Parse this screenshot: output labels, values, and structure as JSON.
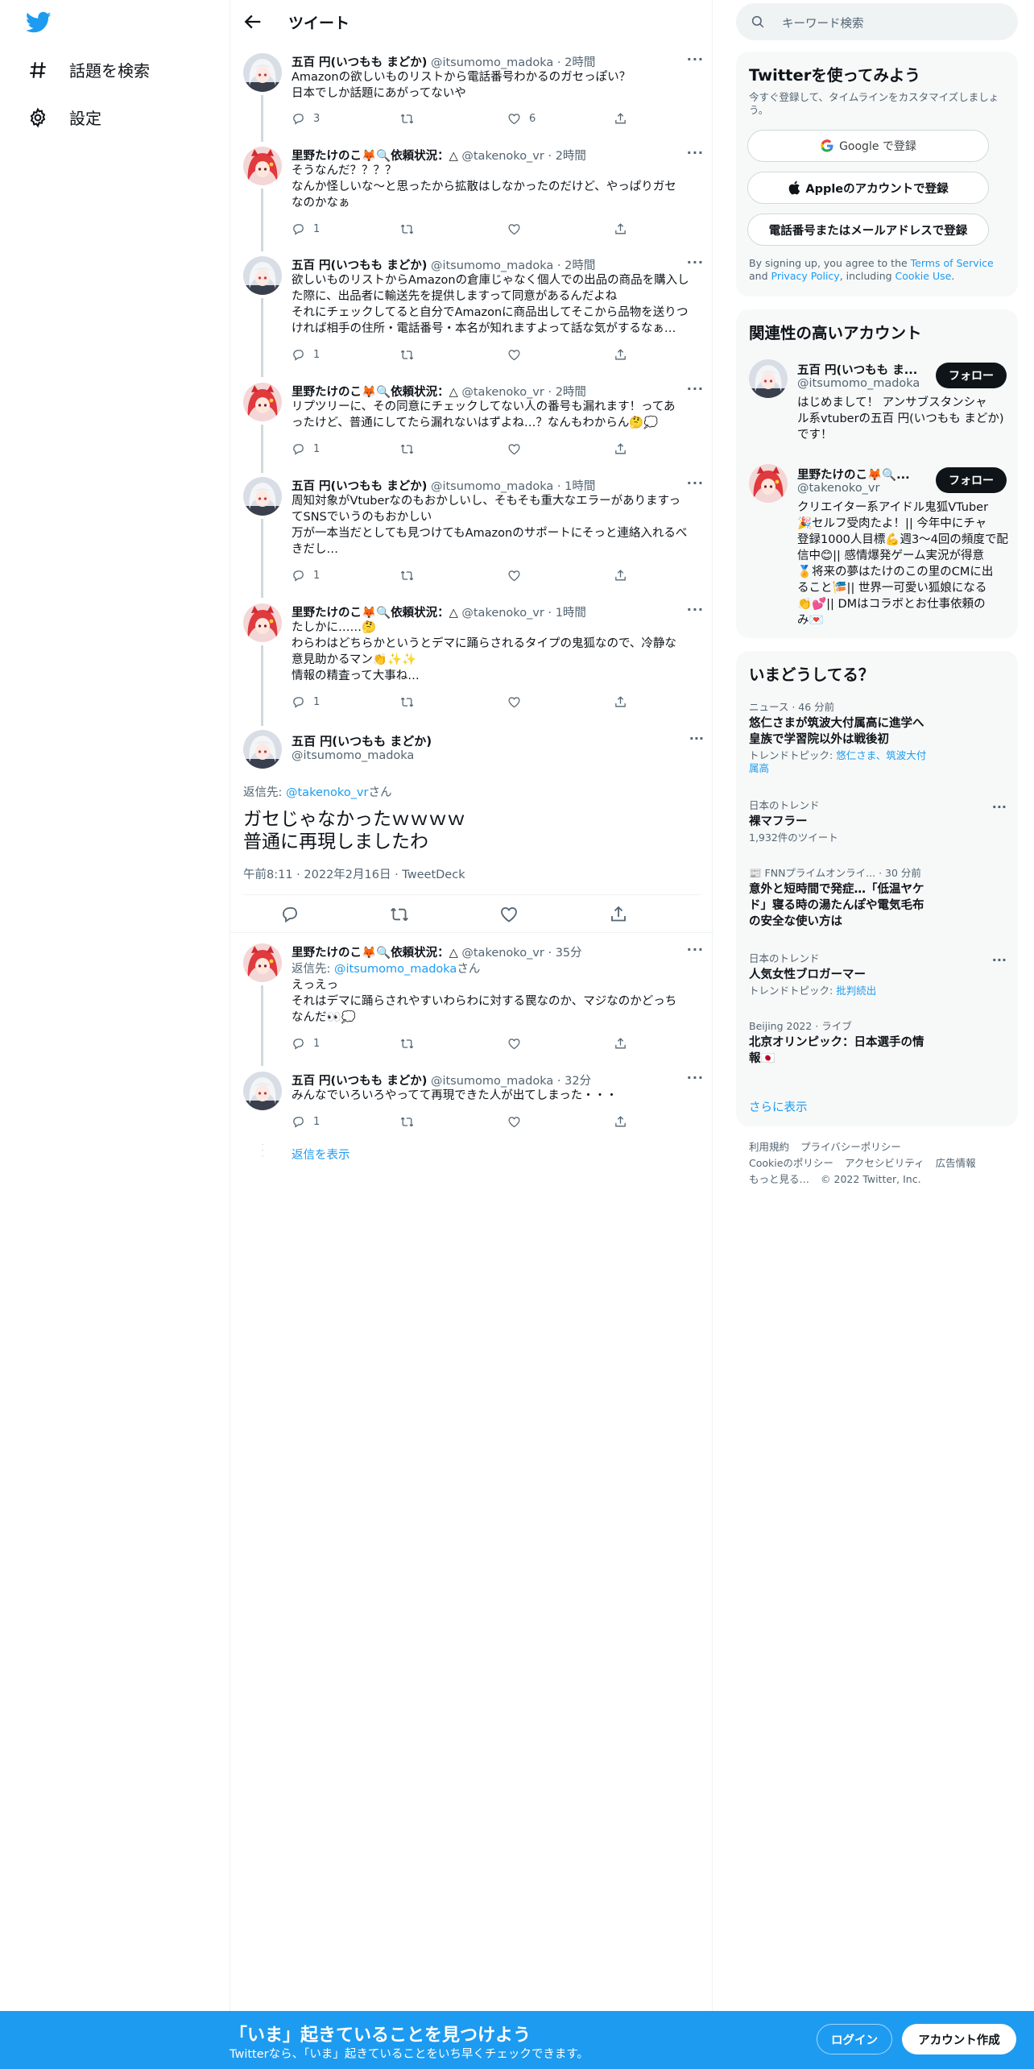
{
  "nav": {
    "logo": "twitter-bird",
    "items": [
      {
        "label": "話題を検索",
        "icon": "hash-icon"
      },
      {
        "label": "設定",
        "icon": "gear-icon"
      }
    ]
  },
  "header": {
    "title": "ツイート"
  },
  "tweets": [
    {
      "name": "五百 円(いつもも まどか)",
      "handle": "@itsumomo_madoka",
      "time": "2時間",
      "lines": [
        "Amazonの欲しいものリストから電話番号わかるのガセっぽい？",
        "日本でしか話題にあがってないや"
      ],
      "replies": "3",
      "retweets": "",
      "likes": "6"
    },
    {
      "name": "里野たけのこ🦊🔍依頼状況：△",
      "handle": "@takenoko_vr",
      "time": "2時間",
      "lines": [
        "そうなんだ？？？？",
        "なんか怪しいな～と思ったから拡散はしなかったのだけど、やっぱりガセ",
        "なのかなぁ"
      ],
      "replies": "1",
      "retweets": "",
      "likes": ""
    },
    {
      "name": "五百 円(いつもも まどか)",
      "handle": "@itsumomo_madoka",
      "time": "2時間",
      "lines": [
        "欲しいものリストからAmazonの倉庫じゃなく個人での出品の商品を購入し",
        "た際に、出品者に輸送先を提供しますって同意があるんだよね",
        "それにチェックしてると自分でAmazonに商品出してそこから品物を送りつ",
        "ければ相手の住所・電話番号・本名が知れますよって話な気がするなぁ…"
      ],
      "replies": "1",
      "retweets": "",
      "likes": ""
    },
    {
      "name": "里野たけのこ🦊🔍依頼状況：△",
      "handle": "@takenoko_vr",
      "time": "2時間",
      "lines": [
        "リプツリーに、その同意にチェックしてない人の番号も漏れます！ってあ",
        "ったけど、普通にしてたら漏れないはずよね…？なんもわからん🤔💭"
      ],
      "replies": "1",
      "retweets": "",
      "likes": ""
    },
    {
      "name": "五百 円(いつもも まどか)",
      "handle": "@itsumomo_madoka",
      "time": "1時間",
      "lines": [
        "周知対象がVtuberなのもおかしいし、そもそも重大なエラーがありますっ",
        "てSNSでいうのもおかしい",
        "万が一本当だとしても見つけてもAmazonのサポートにそっと連絡入れるべ",
        "きだし…"
      ],
      "replies": "1",
      "retweets": "",
      "likes": ""
    },
    {
      "name": "里野たけのこ🦊🔍依頼状況：△",
      "handle": "@takenoko_vr",
      "time": "1時間",
      "lines": [
        "たしかに……🤔",
        "わらわはどちらかというとデマに踊らされるタイプの鬼狐なので、冷静な",
        "意見助かるマン👏✨✨",
        "情報の精査って大事ね…"
      ],
      "replies": "1",
      "retweets": "",
      "likes": ""
    }
  ],
  "main_tweet": {
    "name": "五百 円(いつもも まどか)",
    "handle": "@itsumomo_madoka",
    "reply_prefix": "返信先: ",
    "reply_to": "@takenoko_vr",
    "reply_suffix": "さん",
    "lines": [
      "ガセじゃなかったｗｗｗｗ",
      "普通に再現しましたわ"
    ],
    "timestamp": "午前8:11 · 2022年2月16日 · TweetDeck"
  },
  "replies": [
    {
      "name": "里野たけのこ🦊🔍依頼状況：△",
      "handle": "@takenoko_vr",
      "time": "35分",
      "reply_prefix": "返信先: ",
      "reply_to": "@itsumomo_madoka",
      "reply_suffix": "さん",
      "lines": [
        "えっえっ",
        "それはデマに踊らされやすいわらわに対する罠なのか、マジなのかどっち",
        "なんだ👀💭"
      ],
      "replies": "1",
      "retweets": "",
      "likes": ""
    },
    {
      "name": "五百 円(いつもも まどか)",
      "handle": "@itsumomo_madoka",
      "time": "32分",
      "lines": [
        "みんなでいろいろやってて再現できた人が出てしまった・・・"
      ],
      "replies": "1",
      "retweets": "",
      "likes": ""
    }
  ],
  "show_replies": "返信を表示",
  "right": {
    "search_placeholder": "キーワード検索",
    "signup": {
      "title": "Twitterを使ってみよう",
      "subtitle": "今すぐ登録して、タイムラインをカスタマイズしましょう。",
      "google": "Google で登録",
      "apple": "Appleのアカウントで登録",
      "phone": "電話番号またはメールアドレスで登録",
      "terms_pre": "By signing up, you agree to the ",
      "terms_link": "Terms of Service",
      "terms_and": " and ",
      "privacy_link": "Privacy Policy",
      "terms_mid": ", including ",
      "cookie_link": "Cookie Use",
      "terms_end": "."
    },
    "related": {
      "title": "関連性の高いアカウント",
      "follow_label": "フォロー",
      "accounts": [
        {
          "name": "五百 円(いつもも ま...",
          "handle": "@itsumomo_madoka",
          "bio_lines": [
            "はじめまして！ アンサブスタンシャ",
            "ル系vtuberの五百 円(いつもも まどか)",
            "です！"
          ]
        },
        {
          "name": "里野たけのこ🦊🔍...",
          "handle": "@takenoko_vr",
          "bio_lines": [
            "クリエイター系アイドル鬼狐VTuber",
            "🎉セルフ受肉たよ！|| 今年中にチャ",
            "登録1000人目標💪週3〜4回の頻度で配",
            "信中😊|| 感情爆発ゲーム実況が得意",
            "🏅将来の夢はたけのこの里のCMに出",
            "ること🎏|| 世界一可愛い狐娘になる",
            "👏💕|| DMはコラボとお仕事依頼の",
            "み💌"
          ]
        }
      ]
    },
    "trends": {
      "title": "いまどうしてる？",
      "items": [
        {
          "cat": "ニュース · 46 分前",
          "title_lines": [
            "悠仁さまが筑波大付属高に進学へ",
            "皇族で学習院以外は戦後初"
          ],
          "sub_pre": "トレンドトピック: ",
          "sub_link_lines": [
            "悠仁さま、筑波大付",
            "属高"
          ]
        },
        {
          "cat": "日本のトレンド",
          "title_lines": [
            "裸マフラー"
          ],
          "sub_plain": "1,932件のツイート",
          "more": true
        },
        {
          "cat": "📰 FNNプライムオンライ... · 30 分前",
          "title_lines": [
            "意外と短時間で発症…「低温ヤケ",
            "ド」寝る時の湯たんぽや電気毛布",
            "の安全な使い方は"
          ]
        },
        {
          "cat": "日本のトレンド",
          "title_lines": [
            "人気女性ブロガーマー"
          ],
          "sub_pre": "トレンドトピック: ",
          "sub_link_lines": [
            "批判続出"
          ],
          "more": true
        },
        {
          "cat": "Beijing 2022 · ライブ",
          "title_lines": [
            "北京オリンピック：日本選手の情",
            "報🇯🇵"
          ]
        }
      ],
      "show_more": "さらに表示"
    },
    "footer": {
      "links": [
        "利用規約",
        "プライバシーポリシー",
        "Cookieのポリシー",
        "アクセシビリティ",
        "広告情報",
        "もっと見る…"
      ],
      "copyright": "© 2022 Twitter, Inc."
    }
  },
  "bottombar": {
    "title": "「いま」起きていることを見つけよう",
    "subtitle": "Twitterなら、「いま」起きていることをいち早くチェックできます。",
    "login": "ログイン",
    "signup": "アカウント作成"
  },
  "colors": {
    "accent": "#1d9bf0",
    "text": "#0f1419",
    "muted": "#536471",
    "border": "#eff3f4"
  }
}
